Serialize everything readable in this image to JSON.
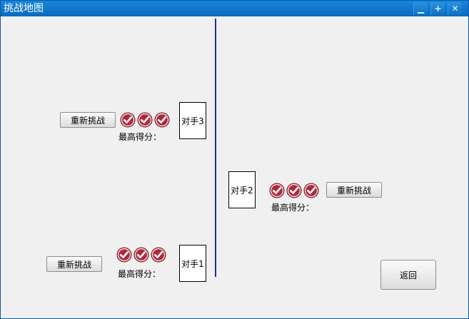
{
  "window": {
    "title": "挑战地图",
    "minimize_icon": "minimize-icon",
    "maximize_icon": "maximize-icon",
    "close_icon": "close-icon",
    "minimize_label": "▁",
    "maximize_label": "+",
    "close_label": "✕"
  },
  "colors": {
    "titlebar": "#0b68bf",
    "check_fill": "#b3263a",
    "divider": "#1d2f8c"
  },
  "opponents": [
    {
      "label": "对手3",
      "retry_label": "重新挑战",
      "best_score_label": "最高得分：",
      "checks": 3
    },
    {
      "label": "对手2",
      "retry_label": "重新挑战",
      "best_score_label": "最高得分：",
      "checks": 3
    },
    {
      "label": "对手1",
      "retry_label": "重新挑战",
      "best_score_label": "最高得分：",
      "checks": 3
    }
  ],
  "back_button": {
    "label": "返回"
  }
}
